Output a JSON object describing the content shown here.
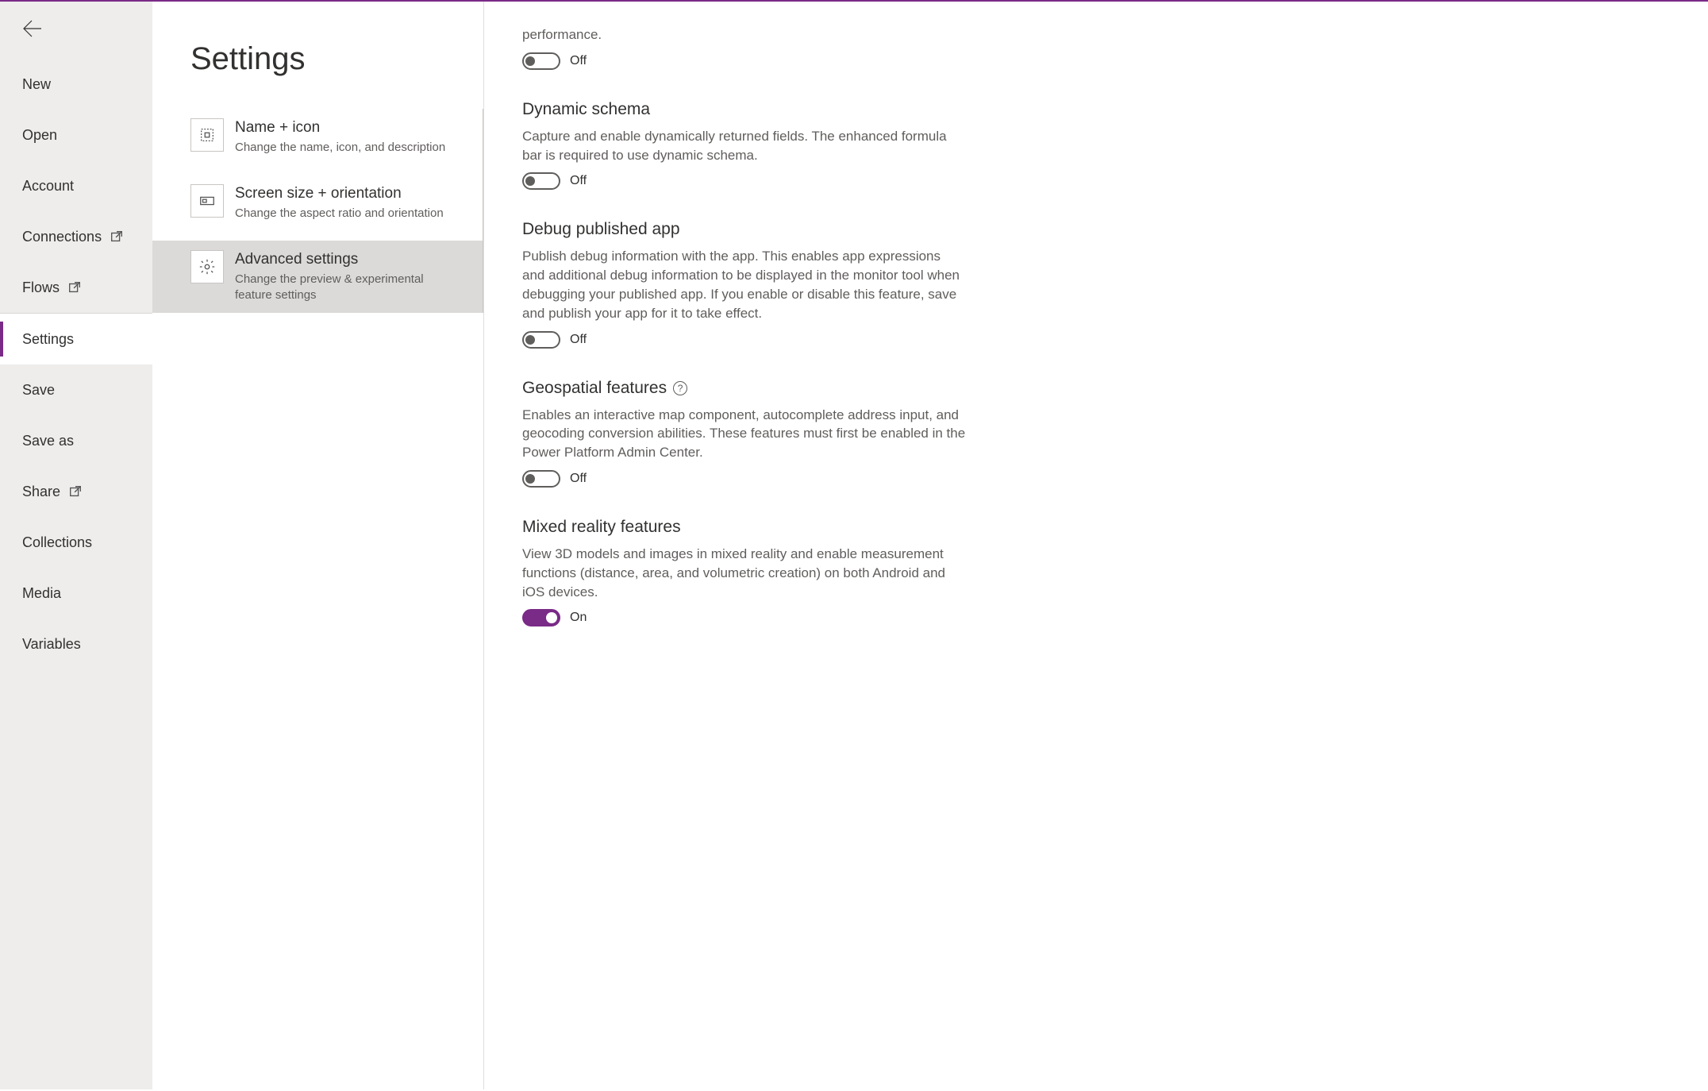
{
  "sidebar": {
    "items": [
      {
        "id": "new",
        "label": "New",
        "external": false,
        "selected": false
      },
      {
        "id": "open",
        "label": "Open",
        "external": false,
        "selected": false
      },
      {
        "id": "account",
        "label": "Account",
        "external": false,
        "selected": false
      },
      {
        "id": "connections",
        "label": "Connections",
        "external": true,
        "selected": false
      },
      {
        "id": "flows",
        "label": "Flows",
        "external": true,
        "selected": false
      },
      {
        "id": "settings",
        "label": "Settings",
        "external": false,
        "selected": true
      },
      {
        "id": "save",
        "label": "Save",
        "external": false,
        "selected": false
      },
      {
        "id": "saveas",
        "label": "Save as",
        "external": false,
        "selected": false
      },
      {
        "id": "share",
        "label": "Share",
        "external": true,
        "selected": false
      },
      {
        "id": "collections",
        "label": "Collections",
        "external": false,
        "selected": false
      },
      {
        "id": "media",
        "label": "Media",
        "external": false,
        "selected": false
      },
      {
        "id": "variables",
        "label": "Variables",
        "external": false,
        "selected": false
      }
    ]
  },
  "page_title": "Settings",
  "categories": [
    {
      "id": "name-icon",
      "icon": "grid-icon",
      "title": "Name + icon",
      "desc": "Change the name, icon, and description",
      "selected": false
    },
    {
      "id": "screen-size",
      "icon": "aspect-icon",
      "title": "Screen size + orientation",
      "desc": "Change the aspect ratio and orientation",
      "selected": false
    },
    {
      "id": "advanced",
      "icon": "gear-icon",
      "title": "Advanced settings",
      "desc": "Change the preview & experimental feature settings",
      "selected": true
    }
  ],
  "features": {
    "top_fragment": "performance.",
    "top_toggle": {
      "state": "off",
      "label": "Off"
    },
    "items": [
      {
        "id": "dynamic-schema",
        "title": "Dynamic schema",
        "desc": "Capture and enable dynamically returned fields. The enhanced formula bar is required to use dynamic schema.",
        "info": false,
        "toggle": {
          "state": "off",
          "label": "Off"
        }
      },
      {
        "id": "debug-published",
        "title": "Debug published app",
        "desc": "Publish debug information with the app. This enables app expressions and additional debug information to be displayed in the monitor tool when debugging your published app. If you enable or disable this feature, save and publish your app for it to take effect.",
        "info": false,
        "toggle": {
          "state": "off",
          "label": "Off"
        }
      },
      {
        "id": "geospatial",
        "title": "Geospatial features",
        "desc": "Enables an interactive map component, autocomplete address input, and geocoding conversion abilities. These features must first be enabled in the Power Platform Admin Center.",
        "info": true,
        "toggle": {
          "state": "off",
          "label": "Off"
        }
      },
      {
        "id": "mixed-reality",
        "title": "Mixed reality features",
        "desc": "View 3D models and images in mixed reality and enable measurement functions (distance, area, and volumetric creation) on both Android and iOS devices.",
        "info": false,
        "toggle": {
          "state": "on",
          "label": "On"
        }
      }
    ]
  },
  "info_glyph": "?"
}
